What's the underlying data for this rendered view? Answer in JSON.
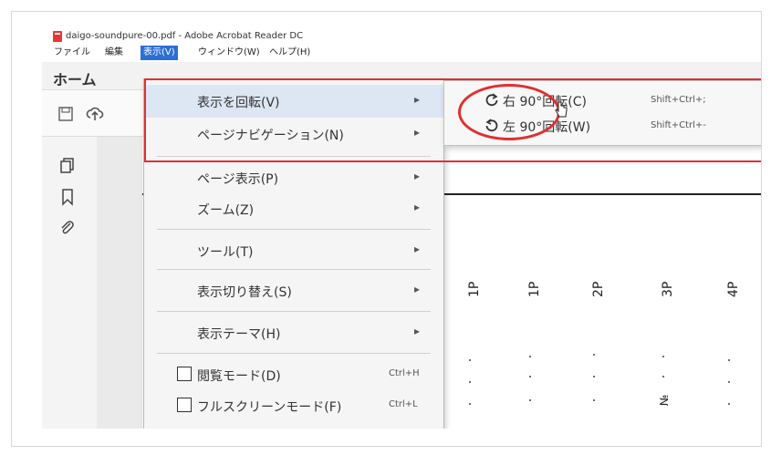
{
  "window": {
    "title": "daigo-soundpure-00.pdf - Adobe Acrobat Reader DC"
  },
  "menubar": {
    "items": [
      "ファイル",
      "編集",
      "表示(V)",
      "ウィンドウ(W)",
      "ヘルプ(H)"
    ]
  },
  "tabs": {
    "home": "ホーム"
  },
  "view_menu": {
    "items": [
      {
        "label": "表示を回転(V)",
        "has_submenu": true
      },
      {
        "label": "ページナビゲーション(N)",
        "has_submenu": true
      },
      {
        "label": "ページ表示(P)",
        "has_submenu": true
      },
      {
        "label": "ズーム(Z)",
        "has_submenu": true
      },
      {
        "label": "ツール(T)",
        "has_submenu": true
      },
      {
        "label": "表示切り替え(S)",
        "has_submenu": true
      },
      {
        "label": "表示テーマ(H)",
        "has_submenu": true
      },
      {
        "label": "閲覧モード(D)",
        "shortcut": "Ctrl+H"
      },
      {
        "label": "フルスクリーンモード(F)",
        "shortcut": "Ctrl+L"
      }
    ]
  },
  "rotate_submenu": {
    "items": [
      {
        "label": "右 90°回転(C)",
        "shortcut": "Shift+Ctrl+;",
        "icon": "rotate-clockwise-icon"
      },
      {
        "label": "左 90°回転(W)",
        "shortcut": "Shift+Ctrl+-",
        "icon": "rotate-counterclockwise-icon"
      }
    ]
  },
  "document": {
    "column_headers": [
      "1P",
      "1P",
      "2P",
      "3P",
      "4P"
    ],
    "symbol": "№"
  },
  "colors": {
    "highlight": "#e03030",
    "menu_active": "#2b6fd6",
    "submenu_bg": "#f7f7f7"
  }
}
